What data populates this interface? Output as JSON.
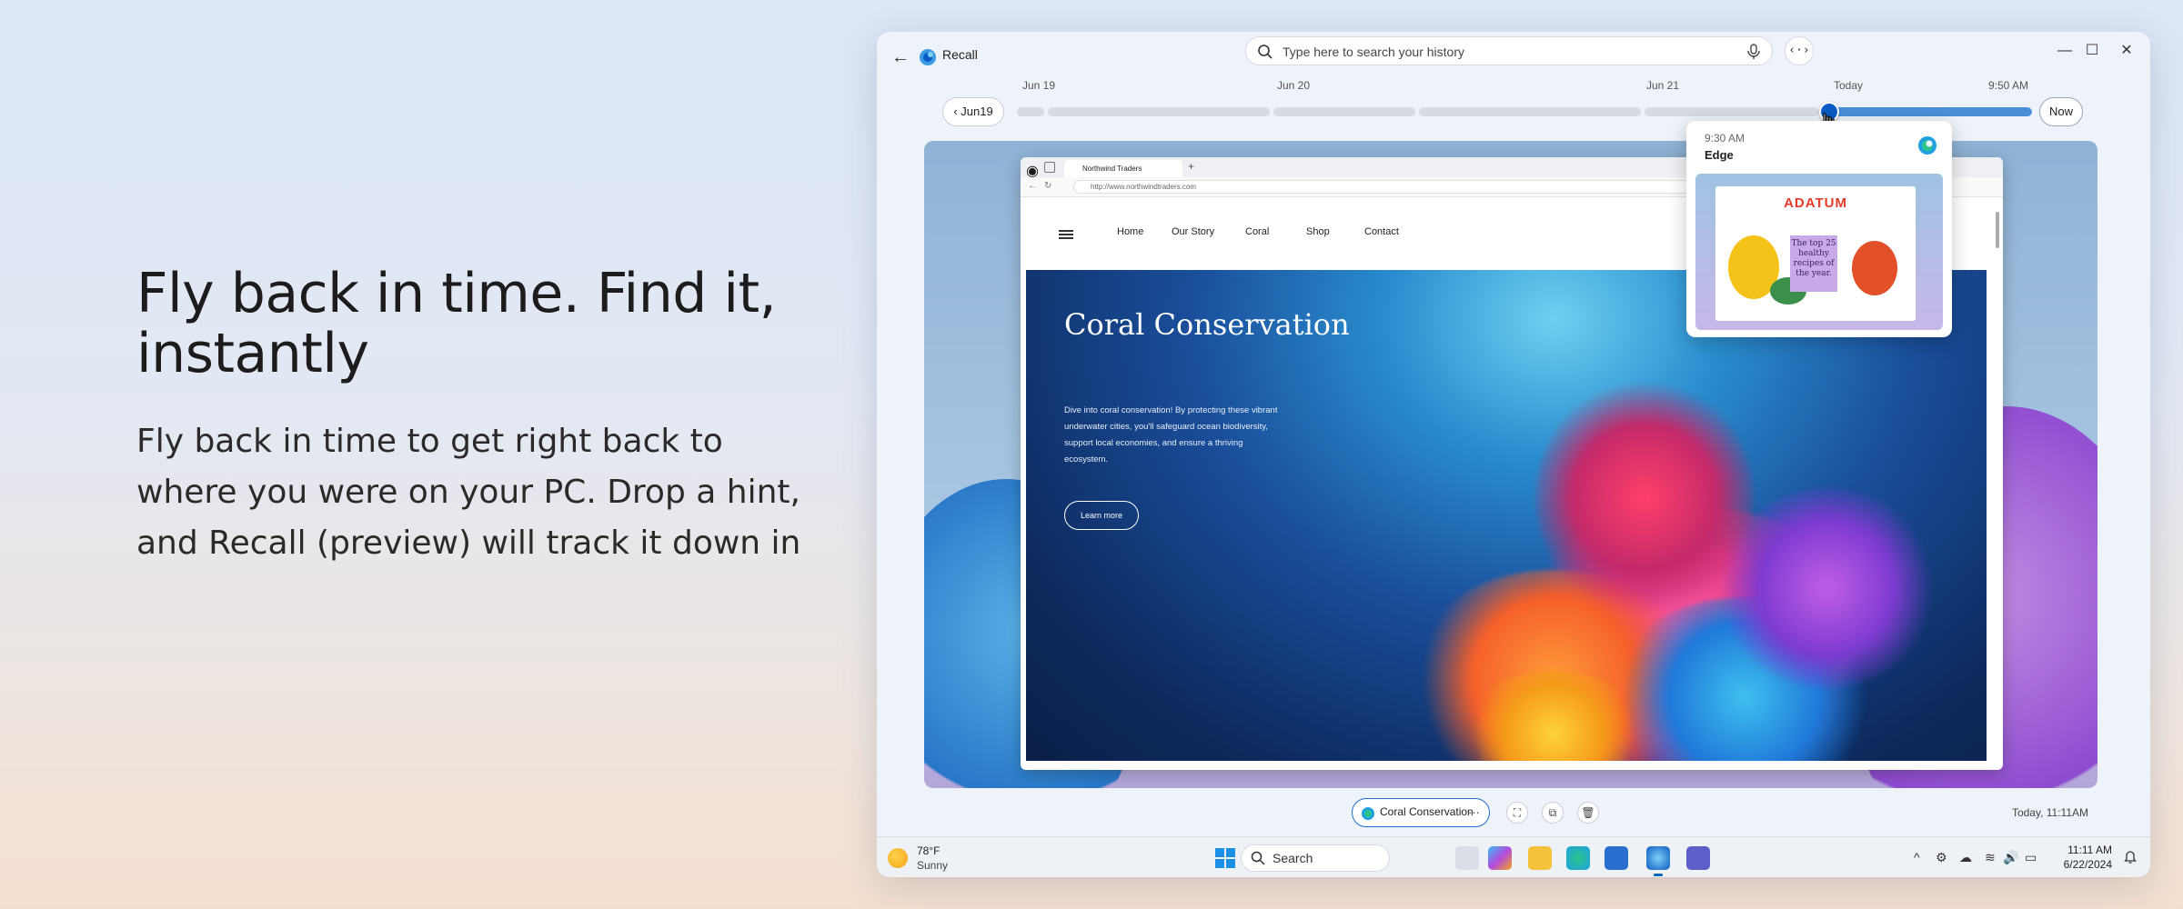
{
  "promo": {
    "heading": "Fly back in time. Find it, instantly",
    "body": "Fly back in time to get right back to where you were on your PC. Drop a hint, and Recall (preview) will track it down in"
  },
  "app": {
    "title": "Recall",
    "search_placeholder": "Type here to search your history",
    "code_button": "‹·›"
  },
  "timeline": {
    "labels": [
      "Jun 19",
      "Jun 20",
      "Jun 21",
      "Today",
      "9:50 AM"
    ],
    "back_button": "Jun19",
    "now_button": "Now",
    "position_fraction": 0.79
  },
  "popup": {
    "time": "9:30 AM",
    "app": "Edge",
    "thumb_brand": "ADATUM",
    "thumb_text": "The top 25 healthy recipes of the year."
  },
  "browser": {
    "tab_title": "Northwind Traders",
    "url": "http://www.northwindtraders.com",
    "nav": [
      "Home",
      "Our Story",
      "Coral",
      "Shop",
      "Contact"
    ],
    "hero_title": "Coral Conservation",
    "hero_desc": "Dive into coral conservation! By protecting these vibrant underwater cities, you'll safeguard ocean biodiversity, support local economies, and ensure a thriving ecosystem.",
    "hero_button": "Learn more"
  },
  "snapshot": {
    "chip_label": "Coral Conservation",
    "timestamp": "Today, 11:11AM"
  },
  "taskbar": {
    "temp": "78°F",
    "condition": "Sunny",
    "search": "Search",
    "time": "11:11 AM",
    "date": "6/22/2024"
  },
  "colors": {
    "accent": "#0067c0",
    "timeline_active": "#4a90d9",
    "adatum_red": "#e63a2a"
  }
}
